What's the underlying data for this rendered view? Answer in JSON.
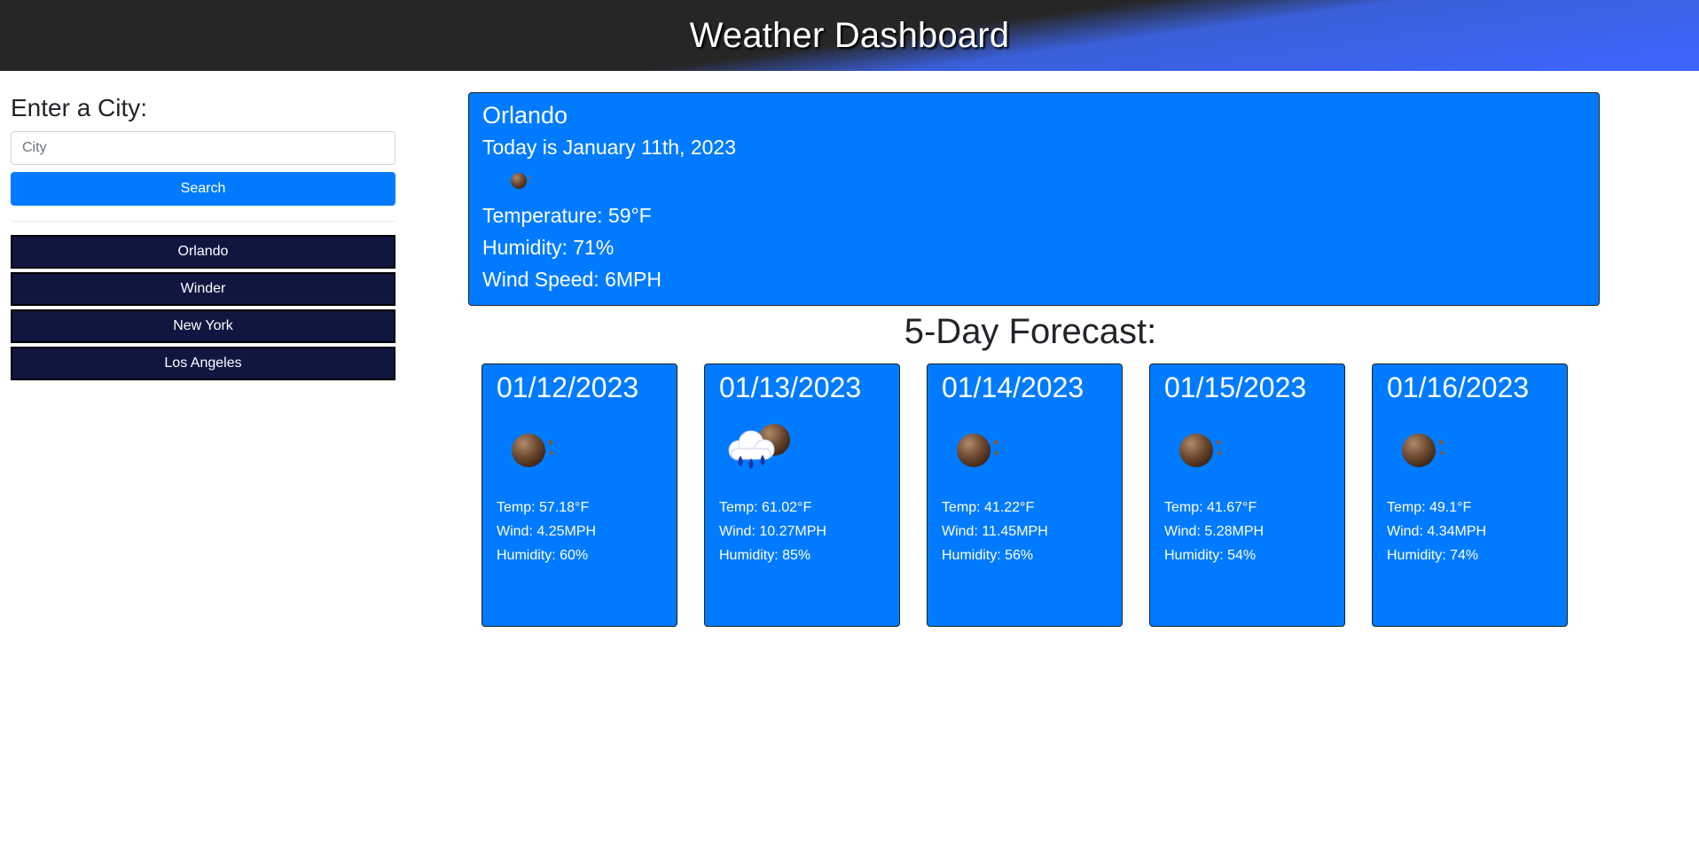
{
  "header": {
    "title": "Weather Dashboard"
  },
  "search": {
    "label": "Enter a City:",
    "placeholder": "City",
    "value": "",
    "button_label": "Search"
  },
  "history": [
    {
      "label": "Orlando"
    },
    {
      "label": "Winder"
    },
    {
      "label": "New York"
    },
    {
      "label": "Los Angeles"
    }
  ],
  "current": {
    "city": "Orlando",
    "date_text": "Today is January 11th, 2023",
    "icon": "clear-night-icon",
    "temperature": "Temperature: 59°F",
    "humidity": "Humidity: 71%",
    "wind": "Wind Speed: 6MPH"
  },
  "forecast": {
    "title": "5-Day Forecast:",
    "days": [
      {
        "date": "01/12/2023",
        "icon": "clear-night-icon",
        "temp": "Temp: 57.18°F",
        "wind": "Wind: 4.25MPH",
        "humidity": "Humidity: 60%"
      },
      {
        "date": "01/13/2023",
        "icon": "rain-night-icon",
        "temp": "Temp: 61.02°F",
        "wind": "Wind: 10.27MPH",
        "humidity": "Humidity: 85%"
      },
      {
        "date": "01/14/2023",
        "icon": "clear-night-icon",
        "temp": "Temp: 41.22°F",
        "wind": "Wind: 11.45MPH",
        "humidity": "Humidity: 56%"
      },
      {
        "date": "01/15/2023",
        "icon": "clear-night-icon",
        "temp": "Temp: 41.67°F",
        "wind": "Wind: 5.28MPH",
        "humidity": "Humidity: 54%"
      },
      {
        "date": "01/16/2023",
        "icon": "clear-night-icon",
        "temp": "Temp: 49.1°F",
        "wind": "Wind: 4.34MPH",
        "humidity": "Humidity: 74%"
      }
    ]
  },
  "colors": {
    "accent": "#007bff",
    "history_button": "#111641",
    "header_dark": "#262626",
    "header_blue": "#3e66ff"
  }
}
